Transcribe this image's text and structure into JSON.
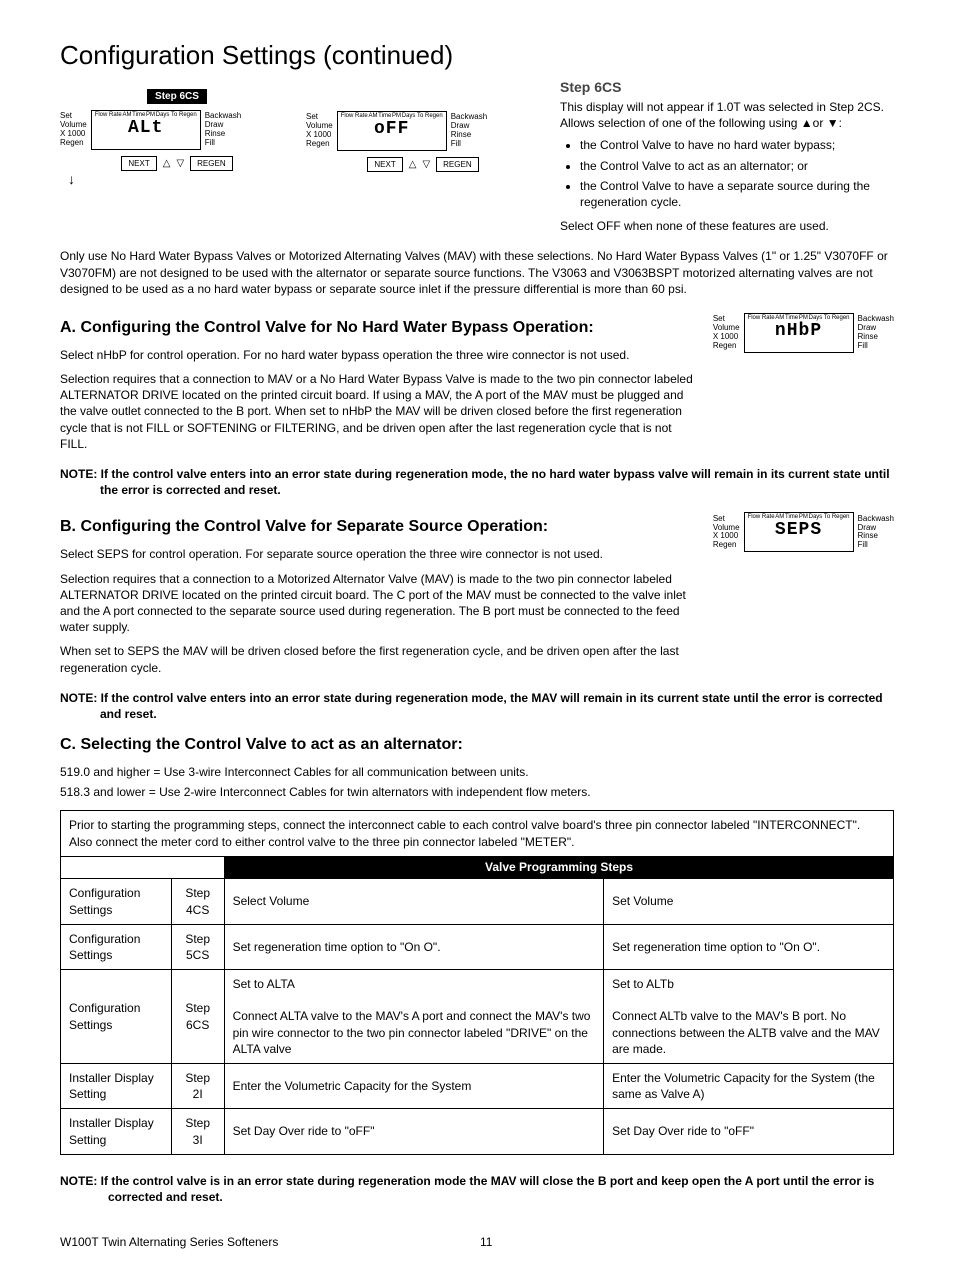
{
  "page_title": "Configuration Settings (continued)",
  "step_label": "Step 6CS",
  "diagram1": {
    "left_labels": "Set\nVolume\nX 1000\nRegen",
    "top_labels": [
      "Flow Rate",
      "AM",
      "Time",
      "PM",
      "Days To Regen"
    ],
    "lcd_text": "ALt",
    "right_labels": "Backwash\nDraw\nRinse\nFill",
    "btn_next": "NEXT",
    "btn_regen": "REGEN"
  },
  "diagram2": {
    "left_labels": "Set\nVolume\nX 1000\nRegen",
    "top_labels": [
      "Flow Rate",
      "AM",
      "Time",
      "PM",
      "Days To Regen"
    ],
    "lcd_text": "oFF",
    "right_labels": "Backwash\nDraw\nRinse\nFill",
    "btn_next": "NEXT",
    "btn_regen": "REGEN"
  },
  "step6cs": {
    "heading": "Step 6CS",
    "p1": "This display will not appear if 1.0T was selected in Step 2CS. Allows selection of one of the following using ▲or ▼:",
    "bullets": [
      "the Control Valve to have no hard water bypass;",
      "the Control Valve to act as an alternator; or",
      "the Control Valve to have a separate source during the regeneration cycle."
    ],
    "p2": "Select OFF when none of these features are used."
  },
  "full_para": "Only use No Hard Water Bypass Valves or Motorized Alternating Valves (MAV) with these selections.  No Hard Water Bypass Valves (1\" or 1.25\" V3070FF or V3070FM) are not designed to be used with the alternator or separate source functions.  The V3063 and V3063BSPT motorized alternating valves are not designed to be used as a no hard water bypass or separate source inlet if the pressure differential is more than 60 psi.",
  "sectionA": {
    "heading": "A.  Configuring the Control Valve for No Hard Water Bypass Operation:",
    "p1": "Select nHbP for control operation.  For no hard water bypass operation the three wire connector is not used.",
    "p2": "Selection requires that a connection to MAV or a No Hard Water Bypass Valve is made to the two pin connector labeled ALTERNATOR DRIVE located on the printed circuit board. If using a MAV, the A port of the MAV must be plugged and the valve outlet connected to the B port.  When set to nHbP the MAV will be driven closed before the first regeneration cycle that is not FILL or SOFTENING or FILTERING, and be driven open after the last regeneration cycle that is not FILL.",
    "note": "NOTE: If the control valve enters into an error state during regeneration mode, the no hard water bypass valve will remain in its current state until the error is corrected and reset.",
    "fig_lcd": "nHbP"
  },
  "sectionB": {
    "heading": "B.  Configuring the Control Valve for Separate Source Operation:",
    "p1": "Select SEPS for control operation.  For separate source operation the three wire connector is not used.",
    "p2": "Selection requires that a connection to a Motorized Alternator Valve (MAV) is made to the two pin connector labeled ALTERNATOR DRIVE located on the printed circuit board. The C port of the MAV must be connected to the valve inlet and the A port connected to the separate source used during regeneration.  The B port must be connected to the feed water supply.",
    "p3": "When set to SEPS the MAV will be driven closed before the first regeneration cycle, and be driven open after the last regeneration cycle.",
    "note": "NOTE: If the control valve enters into an error state during regeneration mode, the MAV will remain in its current state until the error is corrected and reset.",
    "fig_lcd": "SEPS"
  },
  "sectionC": {
    "heading": "C.  Selecting the Control Valve to act as an alternator:",
    "p1": "519.0 and higher = Use 3-wire Interconnect Cables for all communication between units.",
    "p2": "518.3 and lower = Use 2-wire Interconnect Cables for twin alternators with independent flow meters."
  },
  "info_box": "Prior to starting the programming steps, connect the interconnect cable to each control valve board's three pin connector labeled \"INTERCONNECT\".  Also connect the meter cord to either control valve to the three pin connector labeled \"METER\".",
  "table": {
    "header": "Valve Programming Steps",
    "rows": [
      {
        "c1": "Configuration Settings",
        "c2": "Step 4CS",
        "c3": "Select Volume",
        "c4": "Set Volume"
      },
      {
        "c1": "Configuration Settings",
        "c2": "Step 5CS",
        "c3": "Set regeneration time option to \"On O\".",
        "c4": "Set regeneration time option to \"On O\"."
      },
      {
        "c1": "Configuration Settings",
        "c2": "Step 6CS",
        "c3": "Set to ALTA\n\nConnect ALTA valve to the MAV's A port and connect the MAV's two pin wire connector to the two pin connector labeled \"DRIVE\" on the ALTA valve",
        "c4": "Set to ALTb\n\nConnect ALTb valve to the MAV's B port.  No connections between the ALTB valve and the MAV are made."
      },
      {
        "c1": "Installer Display Setting",
        "c2": "Step 2I",
        "c3": "Enter the Volumetric Capacity for the System",
        "c4": "Enter the Volumetric Capacity for the System (the same as Valve A)"
      },
      {
        "c1": "Installer Display Setting",
        "c2": "Step 3I",
        "c3": "Set Day Over ride to \"oFF\"",
        "c4": "Set Day Over ride to \"oFF\""
      }
    ]
  },
  "final_note": "NOTE:  If the control valve is in an error state during regeneration mode the MAV will close the B port and keep open the A port until the error is corrected and reset.",
  "footer_left": "W100T Twin Alternating Series Softeners",
  "footer_page": "11"
}
